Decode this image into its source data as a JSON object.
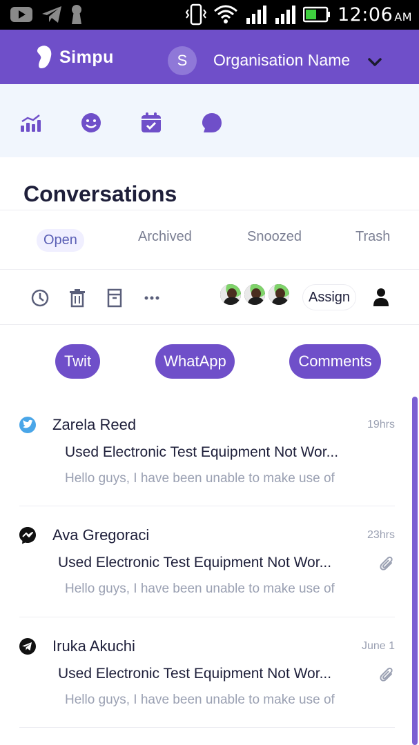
{
  "status_bar": {
    "time": "12:06",
    "ampm": "AM",
    "icons": [
      "youtube-icon",
      "telegram-icon",
      "keyhole-icon",
      "vibrate-icon",
      "wifi-icon",
      "signal-icon",
      "signal-icon",
      "battery-icon"
    ]
  },
  "header": {
    "brand": "Simpu",
    "org_initial": "S",
    "org_name": "Organisation Name",
    "colors": {
      "primary": "#6f4fc9",
      "strip": "#f1f6fd"
    }
  },
  "nav": {
    "icons": [
      "analytics-icon",
      "smiley-icon",
      "calendar-icon",
      "chat-icon"
    ]
  },
  "page": {
    "title": "Conversations"
  },
  "tabs": [
    {
      "label": "Open",
      "active": true
    },
    {
      "label": "Archived",
      "active": false
    },
    {
      "label": "Snoozed",
      "active": false
    },
    {
      "label": "Trash",
      "active": false
    }
  ],
  "actions": {
    "icons": [
      "clock-icon",
      "trash-icon",
      "archive-icon",
      "more-icon"
    ],
    "assign_label": "Assign"
  },
  "filters": [
    "Twit",
    "WhatApp",
    "Comments"
  ],
  "conversations": [
    {
      "channel": "twitter-icon",
      "name": "Zarela Reed",
      "time": "19hrs",
      "subject": "Used Electronic Test Equipment Not Wor...",
      "preview": "Hello guys, I have been unable to make use of",
      "attachment": false
    },
    {
      "channel": "messenger-icon",
      "name": "Ava Gregoraci",
      "time": "23hrs",
      "subject": "Used Electronic Test Equipment Not Wor...",
      "preview": "Hello guys, I have been unable to make use of",
      "attachment": true
    },
    {
      "channel": "telegram-icon",
      "name": "Iruka Akuchi",
      "time": "June 1",
      "subject": "Used Electronic Test Equipment Not Wor...",
      "preview": "Hello guys, I have been unable to make use of",
      "attachment": true
    }
  ]
}
